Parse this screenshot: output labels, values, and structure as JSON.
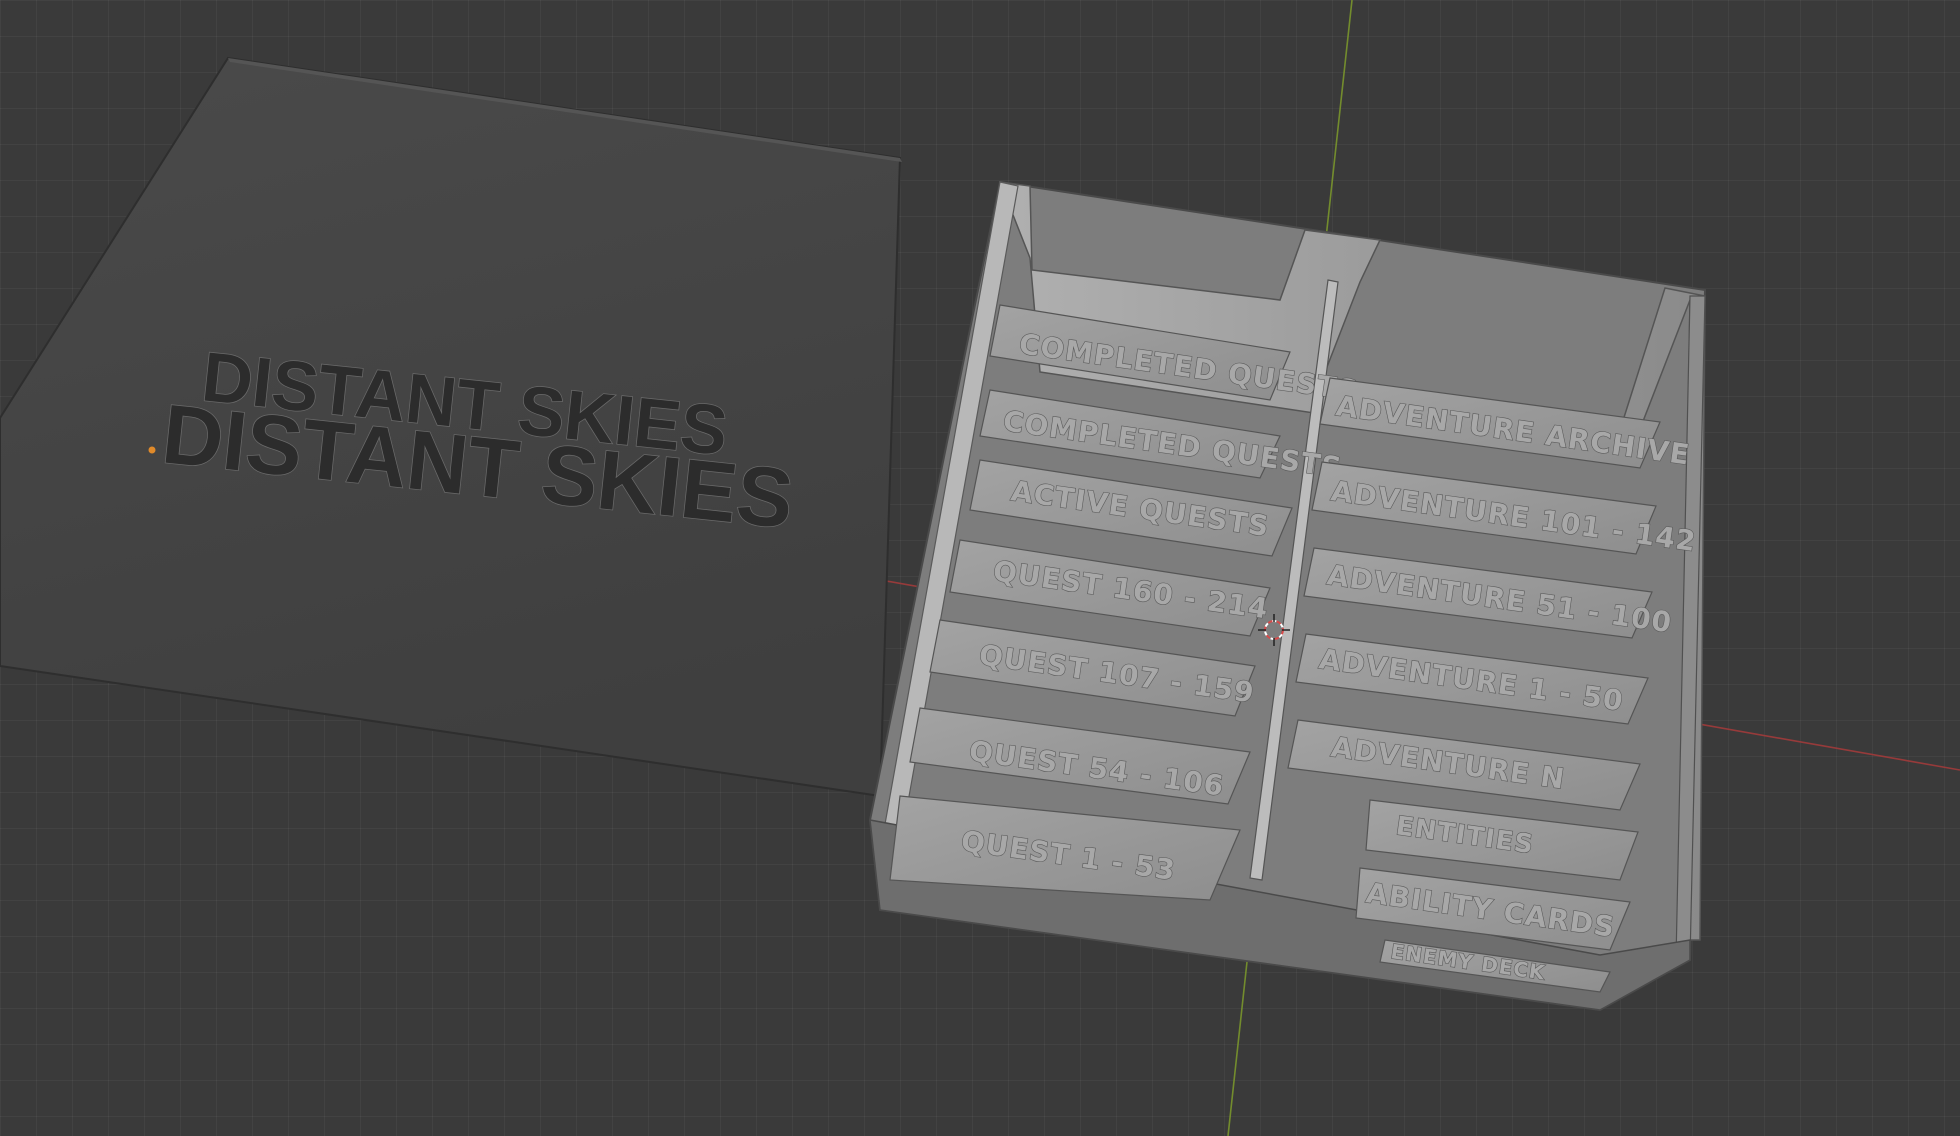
{
  "viewport": {
    "colors": {
      "background": "#3a3a3a",
      "axis_x": "#b03a3a",
      "axis_y": "#7a9a2a",
      "model": "#9a9a9a",
      "model_shadow": "#5e5e5e",
      "lid": "#454545"
    }
  },
  "lid": {
    "text_lines": [
      "DISTANT SKIES",
      "DISTANT SKIES"
    ]
  },
  "tray": {
    "left_slots": [
      "COMPLETED QUESTS",
      "COMPLETED QUESTS",
      "ACTIVE QUESTS",
      "QUEST 160 - 214",
      "QUEST 107 - 159",
      "QUEST 54 - 106",
      "QUEST 1 - 53"
    ],
    "right_slots": [
      "ADVENTURE ARCHIVE",
      "ADVENTURE 101 - 142",
      "ADVENTURE 51 - 100",
      "ADVENTURE 1 - 50",
      "ADVENTURE N",
      "ENTITIES",
      "ABILITY CARDS",
      "ENEMY DECK"
    ]
  },
  "icons": {
    "cursor": "3d-cursor-icon",
    "origin": "origin-dot-icon"
  }
}
